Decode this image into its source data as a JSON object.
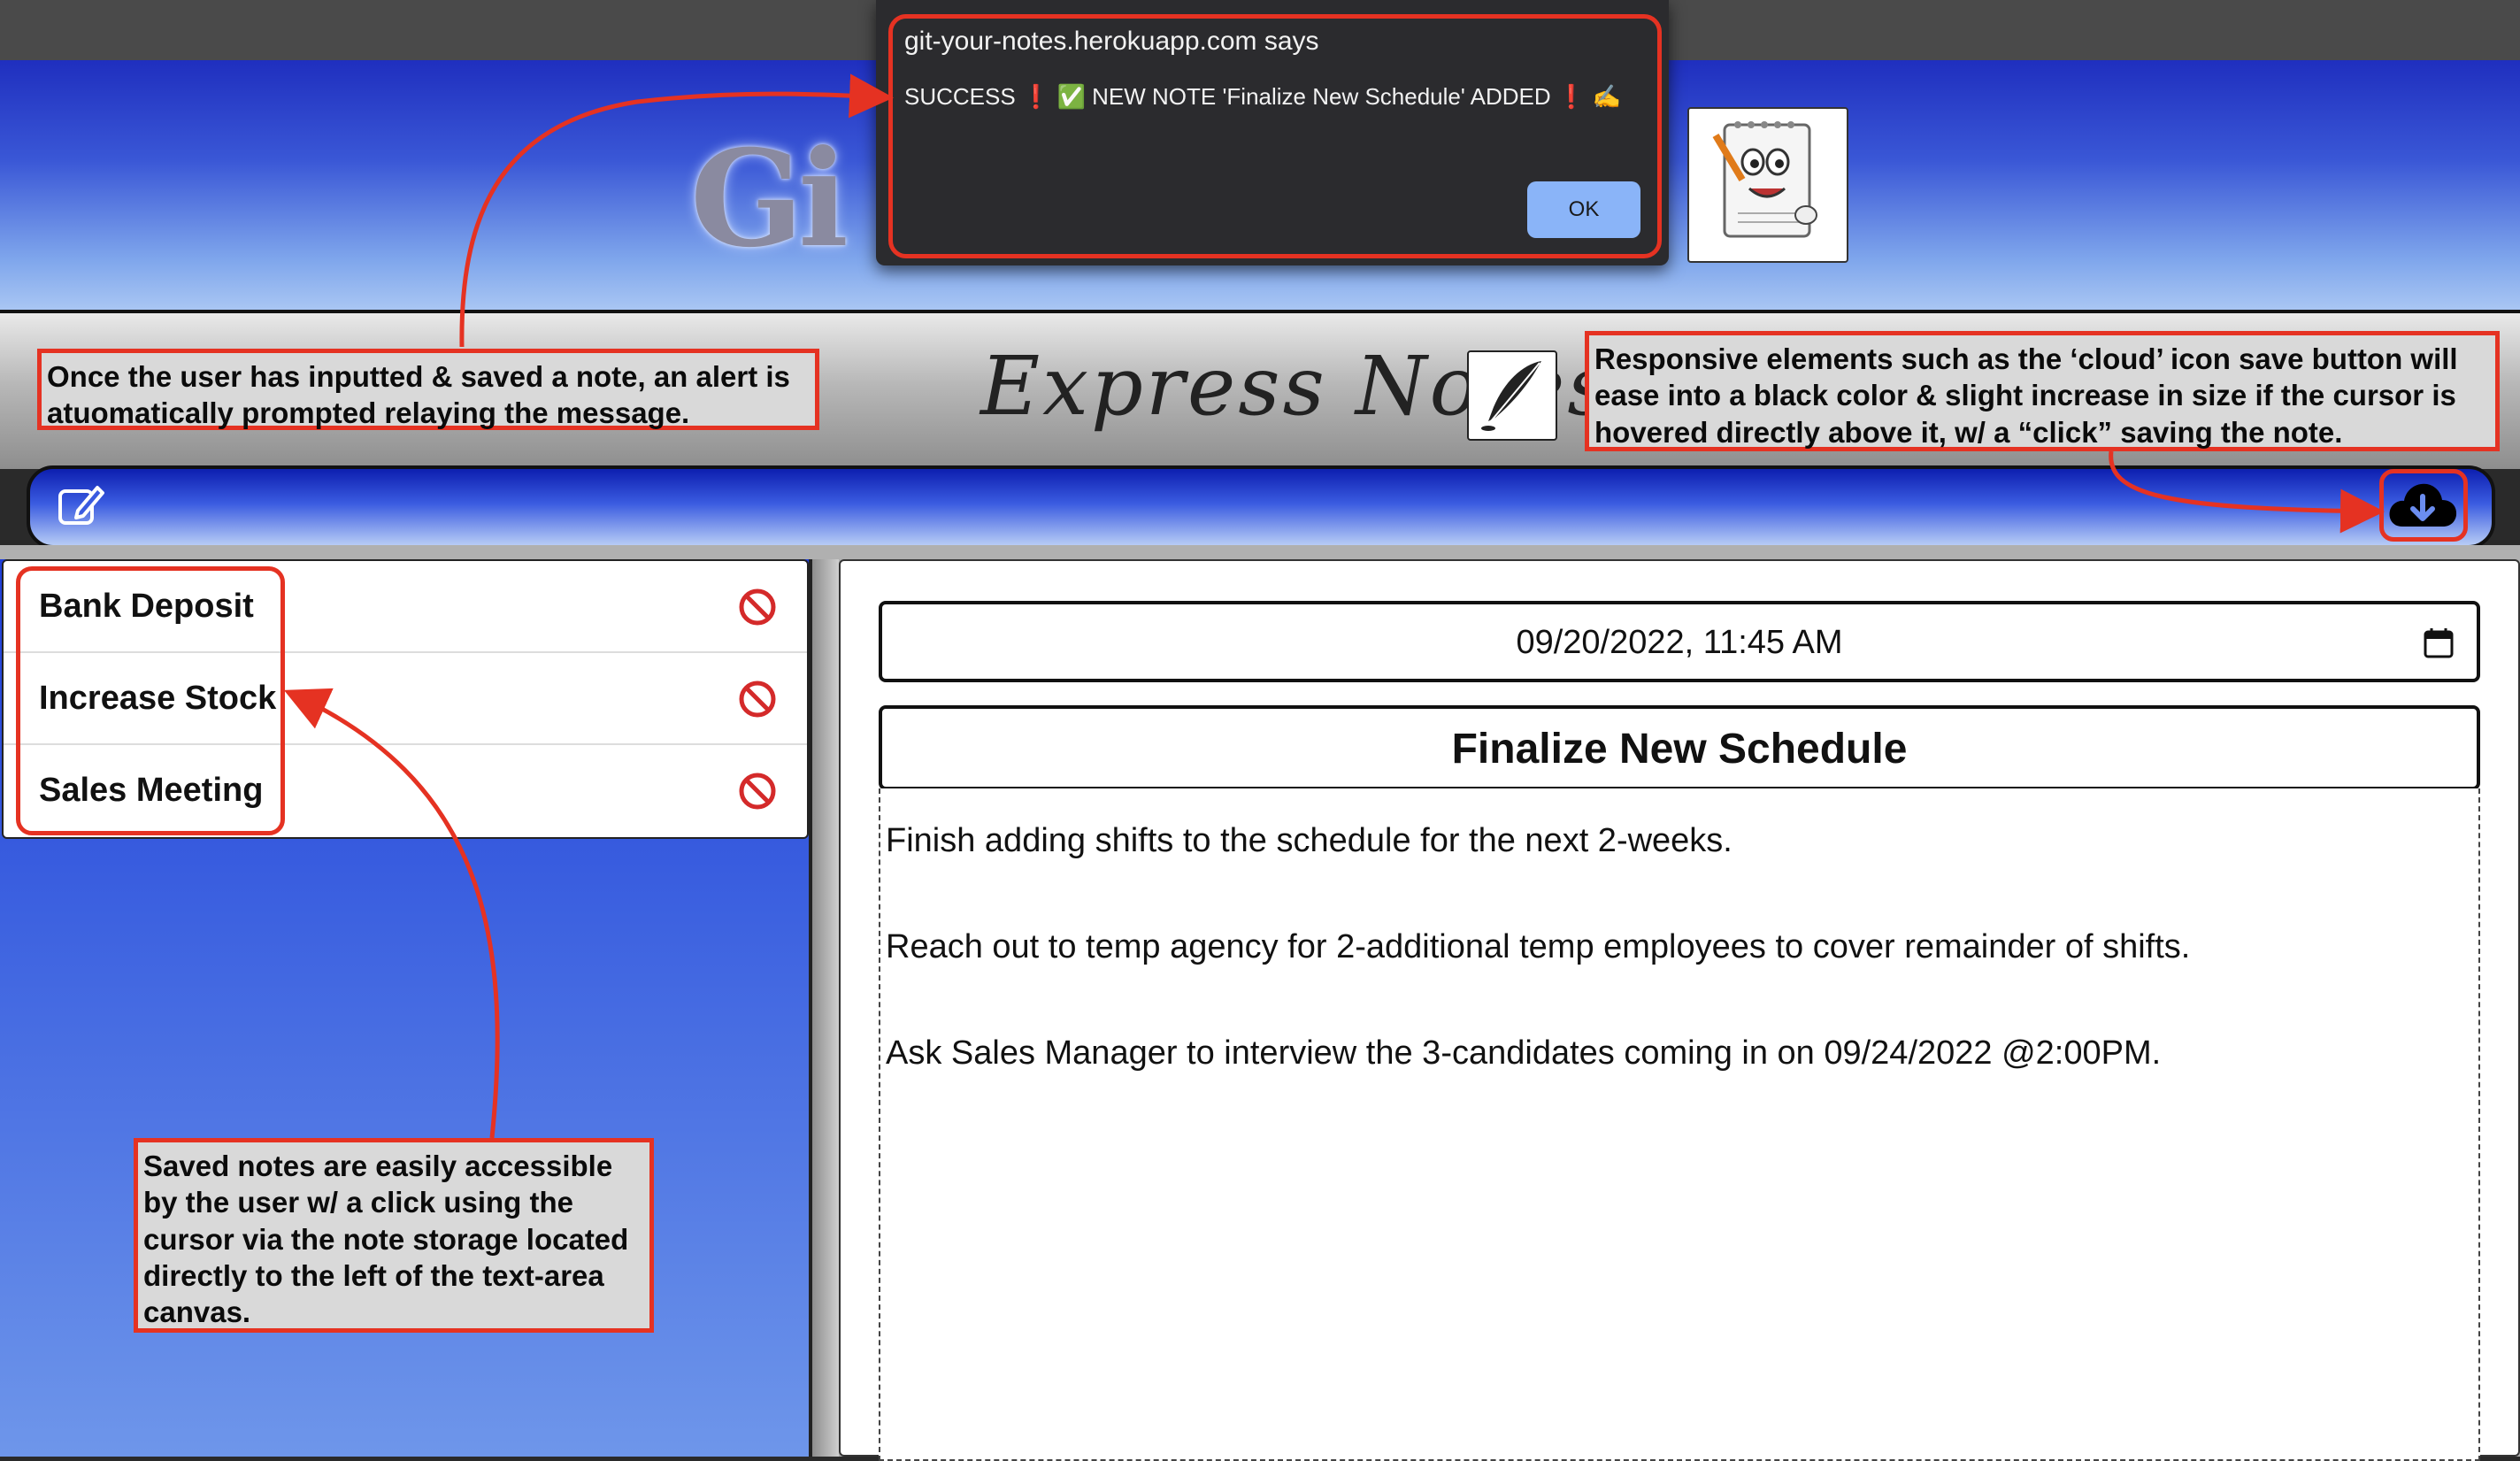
{
  "banner": {
    "logo_text": "Gi"
  },
  "header": {
    "title": "Express Notes"
  },
  "navbar": {
    "new_note_icon": "pencil-square-icon",
    "save_icon": "cloud-download-icon"
  },
  "notes_list": [
    {
      "title": "Bank Deposit"
    },
    {
      "title": "Increase Stock"
    },
    {
      "title": "Sales Meeting"
    }
  ],
  "editor": {
    "datetime": "09/20/2022, 11:45 AM",
    "note_title": "Finalize New Schedule",
    "note_lines": [
      "Finish adding shifts to the schedule for the next 2-weeks.",
      "Reach out to temp agency for 2-additional temp employees to cover remainder of shifts.",
      "Ask Sales Manager to interview the 3-candidates coming in on 09/24/2022 @2:00PM."
    ]
  },
  "alert": {
    "title": "git-your-notes.herokuapp.com says",
    "message": "SUCCESS ❗ ✅ NEW NOTE 'Finalize New Schedule' ADDED ❗ ✍️",
    "ok_label": "OK"
  },
  "annotations": {
    "alert_note": "Once the user has inputted & saved a note, an alert is atuomatically prompted relaying the message.",
    "save_note": "Responsive elements such as the ‘cloud’ icon save button will ease into a black color & slight increase in size if the cursor is hovered directly above it, w/ a “click” saving the note.",
    "list_note": "Saved notes are easily accessible by the user w/ a click using the cursor via the note storage located directly to the left of the text-area canvas."
  },
  "colors": {
    "annotation_red": "#e53222",
    "ok_button": "#8ab4f8",
    "delete_icon_red": "#d42a2a"
  }
}
